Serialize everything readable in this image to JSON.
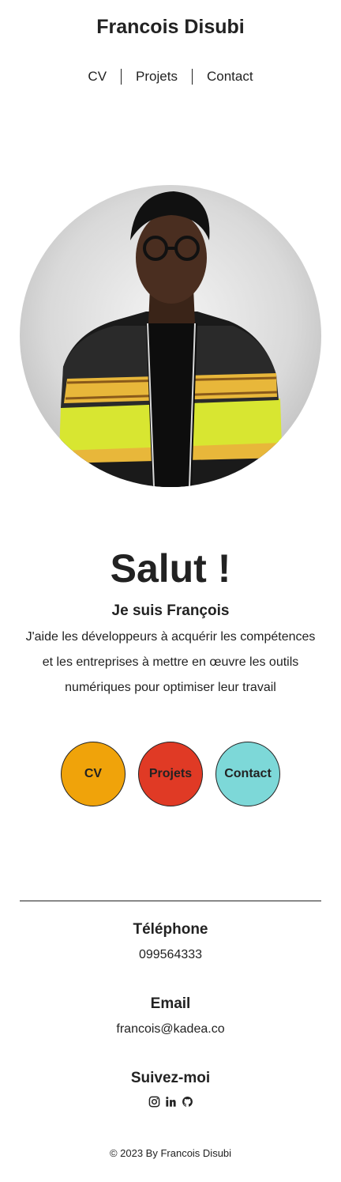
{
  "header": {
    "site_title": "Francois Disubi",
    "nav": [
      "CV",
      "Projets",
      "Contact"
    ]
  },
  "hero": {
    "photo_icon": "portrait-photo",
    "greeting": "Salut !",
    "subtitle": "Je suis François",
    "intro": "J'aide les développeurs à acquérir les compétences et les entreprises à mettre en œuvre les outils numériques pour optimiser leur travail",
    "buttons": [
      {
        "label": "CV",
        "color": "#f0a30a"
      },
      {
        "label": "Projets",
        "color": "#e03a25"
      },
      {
        "label": "Contact",
        "color": "#7dd8d8"
      }
    ]
  },
  "contact": {
    "phone_title": "Téléphone",
    "phone": "099564333",
    "email_title": "Email",
    "email": "francois@kadea.co",
    "follow_title": "Suivez-moi",
    "socials": [
      "instagram-icon",
      "linkedin-icon",
      "github-icon"
    ]
  },
  "footer": {
    "copyright": "© 2023 By Francois Disubi"
  }
}
